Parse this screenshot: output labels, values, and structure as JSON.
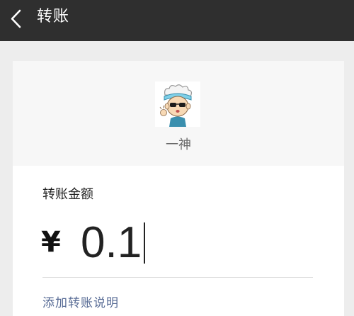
{
  "header": {
    "title": "转账",
    "back_icon": "chevron-left-icon"
  },
  "payee": {
    "name": "一神",
    "avatar_icon": "cartoon-avatar-icon"
  },
  "transfer": {
    "amount_label": "转账金额",
    "currency_symbol": "¥",
    "amount_value": "0.1",
    "add_note_label": "添加转账说明"
  },
  "colors": {
    "titlebar": "#2f2f2f",
    "page_background": "#ededed",
    "link": "#576b95"
  }
}
